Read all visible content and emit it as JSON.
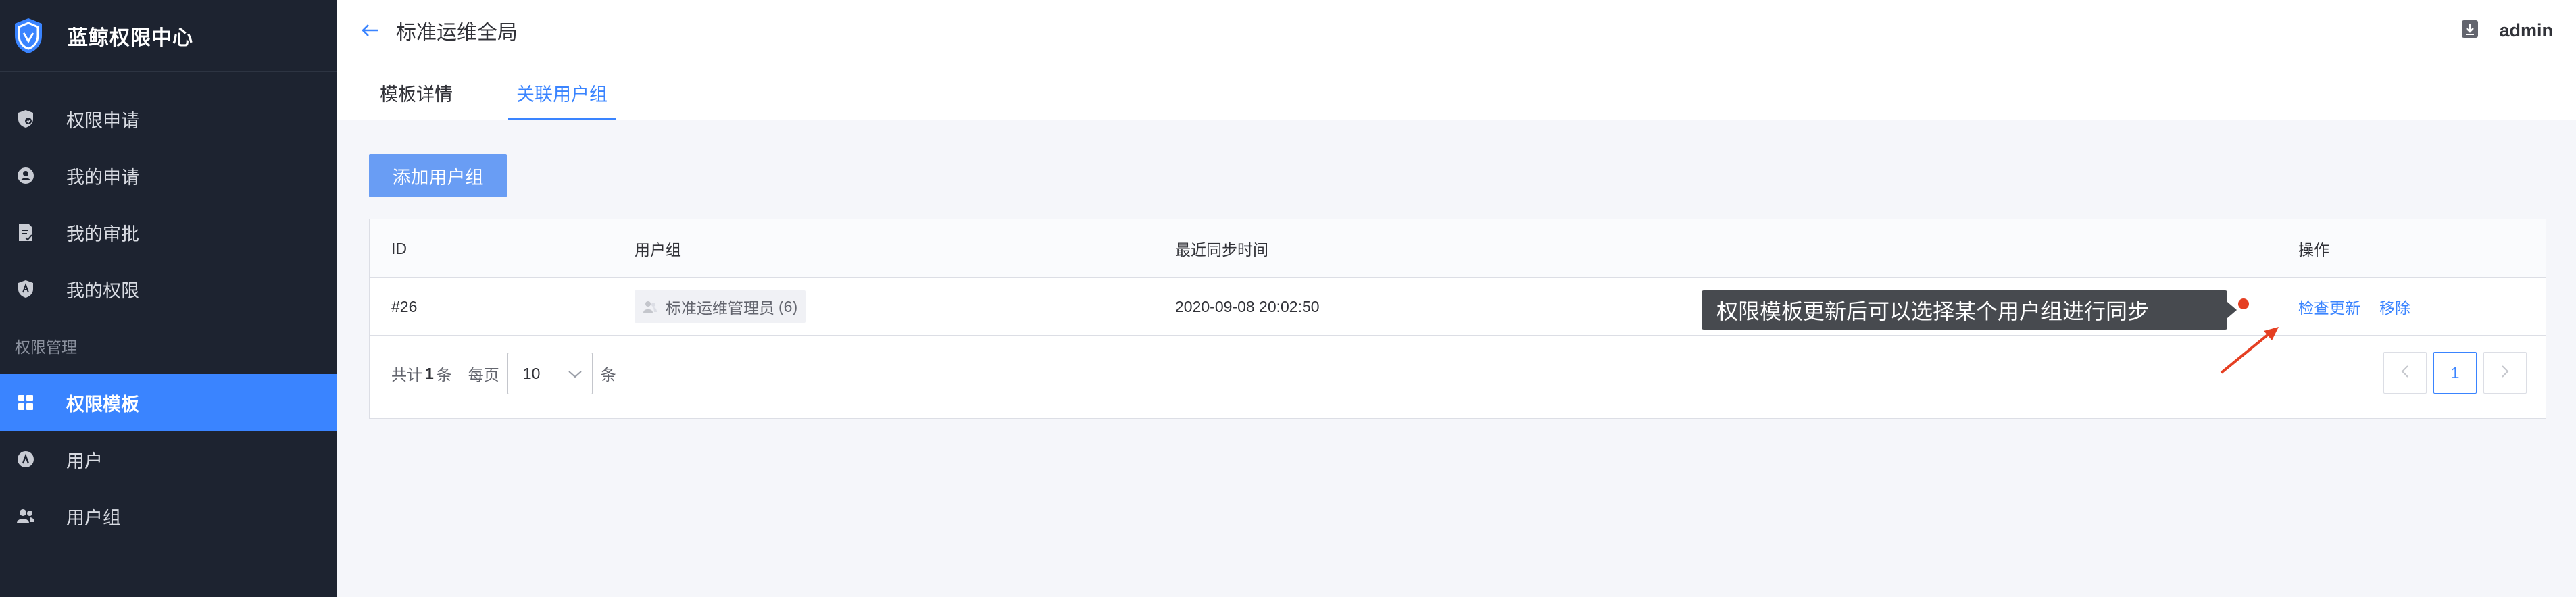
{
  "sidebar": {
    "brand_title": "蓝鲸权限中心",
    "items": [
      {
        "label": "权限申请",
        "icon": "shield-apply-icon"
      },
      {
        "label": "我的申请",
        "icon": "user-circle-icon"
      },
      {
        "label": "我的审批",
        "icon": "document-check-icon"
      },
      {
        "label": "我的权限",
        "icon": "shield-key-icon"
      }
    ],
    "group_label": "权限管理",
    "admin_items": [
      {
        "label": "权限模板",
        "icon": "grid-template-icon",
        "active": true
      },
      {
        "label": "用户",
        "icon": "user-icon"
      },
      {
        "label": "用户组",
        "icon": "users-group-icon"
      }
    ]
  },
  "header": {
    "title": "标准运维全局",
    "user": "admin",
    "tabs": [
      {
        "label": "模板详情",
        "active": false
      },
      {
        "label": "关联用户组",
        "active": true
      }
    ]
  },
  "main": {
    "add_button": "添加用户组",
    "table": {
      "columns": [
        "ID",
        "用户组",
        "最近同步时间",
        "操作"
      ],
      "rows": [
        {
          "id": "#26",
          "group_name": "标准运维管理员",
          "group_count": "(6)",
          "sync_time": "2020-09-08 20:02:50",
          "ops": [
            "检查更新",
            "移除"
          ]
        }
      ]
    },
    "tooltip": "权限模板更新后可以选择某个用户组进行同步",
    "pagination": {
      "total_prefix": "共计",
      "total": "1",
      "total_suffix": "条",
      "per_page_label": "每页",
      "page_size": "10",
      "page_size_unit": "条",
      "current_page": "1"
    }
  },
  "colors": {
    "sidebar_bg": "#1d2330",
    "accent": "#3a84ff",
    "add_button": "#699df4",
    "tooltip_bg": "#474a4f",
    "annotation_red": "#e53f22"
  }
}
